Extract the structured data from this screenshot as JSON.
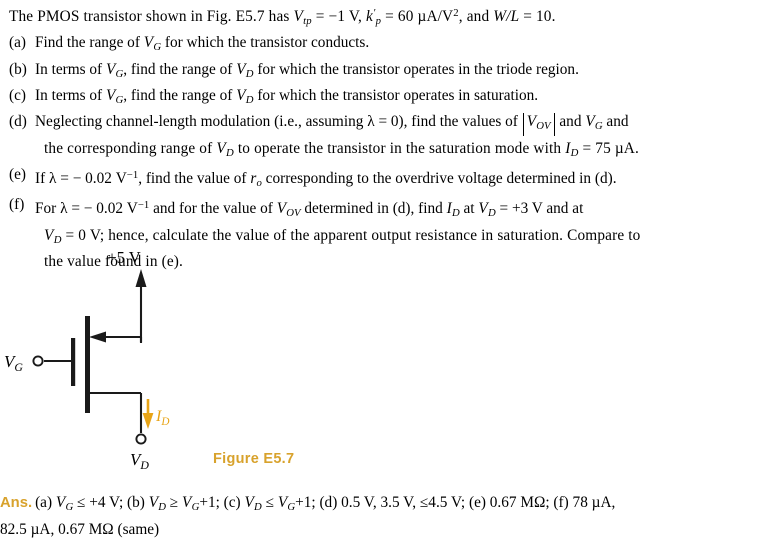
{
  "document": {
    "kind": "textbook-exercise",
    "exercise_id": "E5.7"
  },
  "colors": {
    "accent_gold": "#d8a22c",
    "circuit_ink": "#1a1a1a",
    "current_arrow": "#e8a417",
    "text": "#000000",
    "background": "#ffffff"
  },
  "statement": {
    "intro": {
      "text_plain": "The PMOS transistor shown in Fig. E5.7 has Vtp = -1 V, k'p = 60 µA/V², and W/L = 10.",
      "part1": "The PMOS transistor shown in Fig. E5.7 has ",
      "sym_vtp": "V",
      "sub_vtp": "tp",
      "eq_vtp": " = −1 V, ",
      "sym_kp": "k",
      "prime_kp": "′",
      "sub_kp": "p",
      "eq_kp": " = 60 µA/V",
      "exp_kp": "2",
      "part_wl": ", and ",
      "sym_wl": "W/L",
      "eq_wl": " = 10."
    },
    "items": [
      {
        "tag": "(a)",
        "text_plain": "Find the range of VG for which the transistor conducts.",
        "pre": "Find the range of ",
        "sym1": "V",
        "sub1": "G",
        "post": " for which the transistor conducts."
      },
      {
        "tag": "(b)",
        "text_plain": "In terms of VG, find the range of VD for which the transistor operates in the triode region.",
        "pre": "In terms of ",
        "sym1": "V",
        "sub1": "G",
        "mid": ", find the range of ",
        "sym2": "V",
        "sub2": "D",
        "post": " for which the transistor operates in the triode region."
      },
      {
        "tag": "(c)",
        "text_plain": "In terms of VG, find the range of VD for which the transistor operates in saturation.",
        "pre": "In terms of ",
        "sym1": "V",
        "sub1": "G",
        "mid": ", find the range of ",
        "sym2": "V",
        "sub2": "D",
        "post": " for which the transistor operates in saturation."
      },
      {
        "tag": "(d)",
        "text_plain": "Neglecting channel-length modulation (i.e., assuming λ = 0), find the values of |VOV| and VG and the corresponding range of VD to operate the transistor in the saturation mode with ID = 75 µA.",
        "l1_pre": "Neglecting channel-length modulation (i.e., assuming λ = 0), find the values of ",
        "l1_abs_sym": "V",
        "l1_abs_sub": "OV",
        "l1_mid": " and ",
        "l1_sym2": "V",
        "l1_sub2": "G",
        "l1_end": " and",
        "l2_pre": "the corresponding range of ",
        "l2_sym1": "V",
        "l2_sub1": "D",
        "l2_mid": " to operate the transistor in the saturation mode with ",
        "l2_sym2": "I",
        "l2_sub2": "D",
        "l2_end": " = 75 µA."
      },
      {
        "tag": "(e)",
        "text_plain": "If λ = -0.02 V⁻¹, find the value of ro corresponding to the overdrive voltage determined in (d).",
        "pre": "If λ = − 0.02 V",
        "exp": "−1",
        "mid": ", find the value of ",
        "sym1": "r",
        "sub1": "o",
        "post": " corresponding to the overdrive voltage determined in (d)."
      },
      {
        "tag": "(f)",
        "text_plain": "For λ = -0.02 V⁻¹ and for the value of VOV determined in (d), find ID at VD = +3 V and at VD = 0 V; hence, calculate the value of the apparent output resistance in saturation. Compare to the value found in (e).",
        "l1_pre": "For λ = − 0.02 V",
        "l1_exp": "−1",
        "l1_mid": " and for the value of ",
        "l1_sym1": "V",
        "l1_sub1": "OV",
        "l1_mid2": " determined in (d), find ",
        "l1_sym2": "I",
        "l1_sub2": "D",
        "l1_mid3": " at ",
        "l1_sym3": "V",
        "l1_sub3": "D",
        "l1_end": " = +3 V and at",
        "l2_sym1": "V",
        "l2_sub1": "D",
        "l2_mid": " = 0 V; hence, calculate the value of the apparent output resistance in saturation. Compare to",
        "l3": "the value found in (e)."
      }
    ]
  },
  "figure": {
    "caption": "Figure E5.7",
    "supply_label": "+5 V",
    "gate_label_sym": "V",
    "gate_label_sub": "G",
    "drain_label_sym": "V",
    "drain_label_sub": "D",
    "current_label_sym": "I",
    "current_label_sub": "D",
    "device_type": "PMOS transistor",
    "source_arrow_direction": "into-channel-pointing-left",
    "current_arrow_direction": "down"
  },
  "answers": {
    "label": "Ans.",
    "line1_plain": "(a) VG ≤ +4 V; (b) VD ≥ VG+1; (c) VD ≤ VG+1; (d) 0.5 V, 3.5 V, ≤4.5 V; (e) 0.67 MΩ; (f) 78 µA,",
    "line2_plain": "82.5 µA, 0.67 MΩ (same)",
    "parts": [
      {
        "tag": "(a)",
        "value": "VG ≤ +4 V"
      },
      {
        "tag": "(b)",
        "value": "VD ≥ VG+1"
      },
      {
        "tag": "(c)",
        "value": "VD ≤ VG+1"
      },
      {
        "tag": "(d)",
        "value": "0.5 V, 3.5 V, ≤4.5 V"
      },
      {
        "tag": "(e)",
        "value": "0.67 MΩ"
      },
      {
        "tag": "(f)",
        "value": "78 µA, 82.5 µA, 0.67 MΩ (same)"
      }
    ],
    "tok": {
      "a_tag": "(a)",
      "a_sym": "V",
      "a_sub": "G",
      "a_rest": " ≤ +4 V; ",
      "b_tag": "(b)",
      "b_sym1": "V",
      "b_sub1": "D",
      "b_mid": " ≥ ",
      "b_sym2": "V",
      "b_sub2": "G",
      "b_rest": "+1; ",
      "c_tag": "(c)",
      "c_sym1": "V",
      "c_sub1": "D",
      "c_mid": " ≤ ",
      "c_sym2": "V",
      "c_sub2": "G",
      "c_rest": "+1; ",
      "d_tag": "(d)",
      "d_val": " 0.5 V, 3.5 V, ≤4.5 V; ",
      "e_tag": "(e)",
      "e_val": " 0.67 MΩ; ",
      "f_tag": "(f)",
      "f_val": " 78 µA,",
      "line2": "82.5 µA, 0.67 MΩ (same)"
    }
  }
}
